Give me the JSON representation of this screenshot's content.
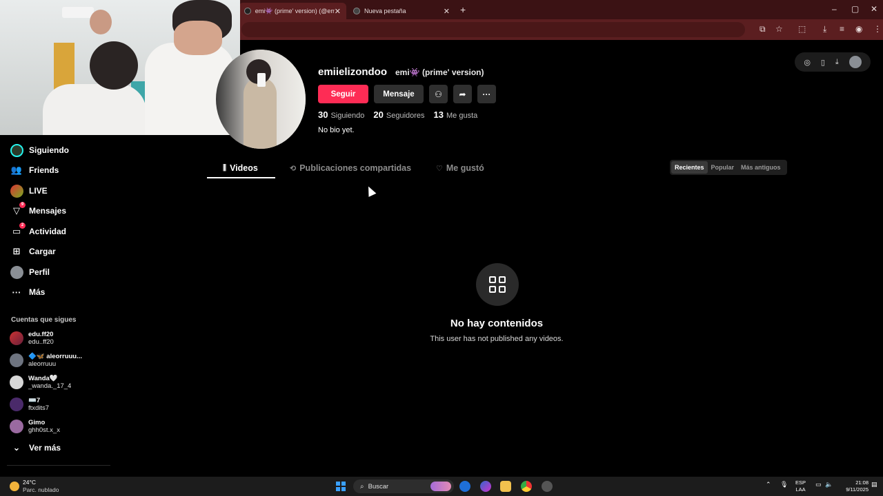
{
  "browser": {
    "tabs": [
      {
        "title": "emi👾 (prime' version) (@emi…",
        "active": true
      },
      {
        "title": "Nueva pestaña",
        "active": false
      }
    ],
    "new_tab": "+",
    "window_controls": [
      "–",
      "▢",
      "✕"
    ]
  },
  "sidebar": {
    "items": [
      {
        "label": "Siguiendo",
        "icon": "following-avatar-icon"
      },
      {
        "label": "Friends",
        "icon": "friends-icon"
      },
      {
        "label": "LIVE",
        "icon": "live-icon"
      },
      {
        "label": "Mensajes",
        "icon": "messages-icon",
        "badge": "9"
      },
      {
        "label": "Actividad",
        "icon": "activity-icon",
        "badge": "2"
      },
      {
        "label": "Cargar",
        "icon": "upload-icon"
      },
      {
        "label": "Perfil",
        "icon": "profile-icon"
      },
      {
        "label": "Más",
        "icon": "more-icon"
      }
    ],
    "following_label": "Cuentas que sigues",
    "following": [
      {
        "name": "edu.ff20",
        "user": "edu..ff20"
      },
      {
        "name": "🔷🦋 aleorruuu...",
        "user": "aleorruuu"
      },
      {
        "name": "Wanda🤍",
        "user": "_wanda._17_4"
      },
      {
        "name": "⌨️7",
        "user": "ftxdits7"
      },
      {
        "name": "Gimo",
        "user": "ghh0st.x_x"
      }
    ],
    "see_more": "Ver más"
  },
  "profile": {
    "username": "emiielizondoo",
    "nickname": "emi👾 (prime' version)",
    "follow_label": "Seguir",
    "message_label": "Mensaje",
    "stats": [
      {
        "value": "30",
        "label": "Siguiendo"
      },
      {
        "value": "20",
        "label": "Seguidores"
      },
      {
        "value": "13",
        "label": "Me gusta"
      }
    ],
    "bio": "No bio yet."
  },
  "tabs": [
    {
      "label": "Videos",
      "active": true
    },
    {
      "label": "Publicaciones compartidas",
      "active": false
    },
    {
      "label": "Me gustó",
      "active": false
    }
  ],
  "sort": [
    {
      "label": "Recientes",
      "active": true
    },
    {
      "label": "Popular",
      "active": false
    },
    {
      "label": "Más antiguos",
      "active": false
    }
  ],
  "empty": {
    "title": "No hay contenidos",
    "subtitle": "This user has not published any videos."
  },
  "taskbar": {
    "temp": "24°C",
    "condition": "Parc. nublado",
    "search_placeholder": "Buscar",
    "lang_line1": "ESP",
    "lang_line2": "LAA",
    "time": "21:08",
    "date": "9/11/2025"
  },
  "colors": {
    "accent": "#fe2c55",
    "browser_frame": "#5b1e20",
    "background": "#000000"
  }
}
